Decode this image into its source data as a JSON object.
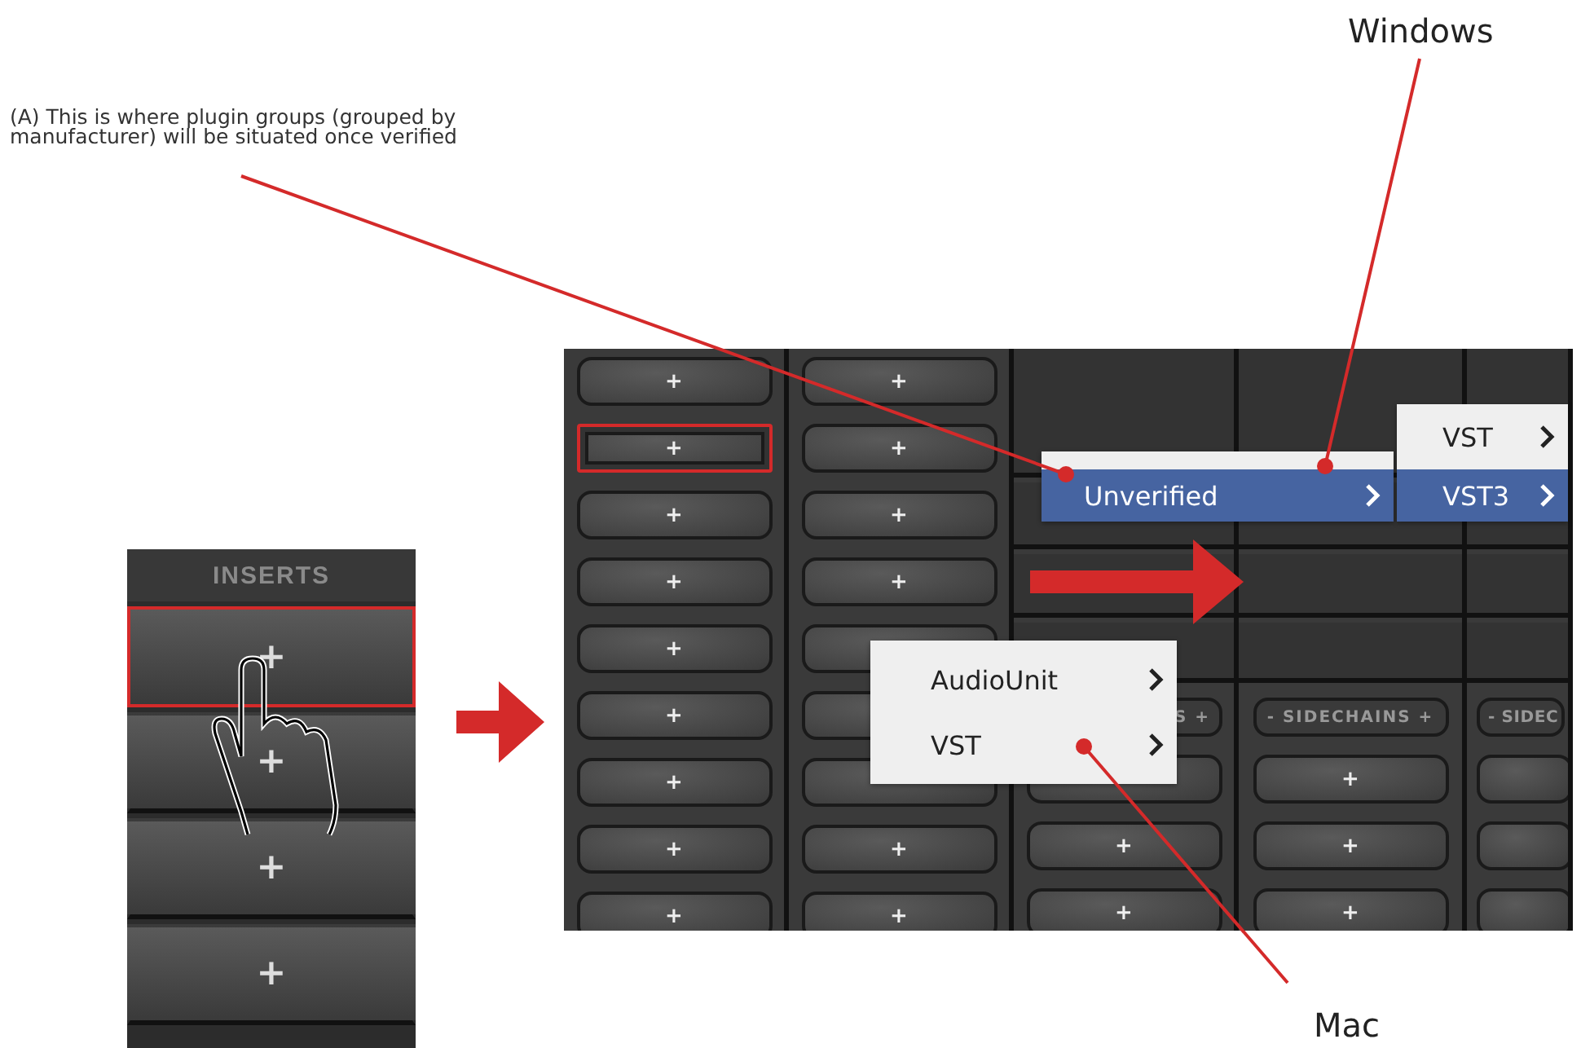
{
  "annotations": {
    "caption": "(A) This is where plugin groups (grouped by manufacturer) will be situated once verified",
    "windows_label": "Windows",
    "mac_label": "Mac"
  },
  "inserts_panel": {
    "header": "INSERTS",
    "slots": [
      {
        "label": "+",
        "highlighted": true
      },
      {
        "label": "+",
        "highlighted": false
      },
      {
        "label": "+",
        "highlighted": false
      },
      {
        "label": "+",
        "highlighted": false
      }
    ]
  },
  "mixer": {
    "columns": [
      {
        "kind": "slots",
        "slots": [
          {
            "kind": "plus",
            "label": "+",
            "highlighted": false
          },
          {
            "kind": "plus",
            "label": "+",
            "highlighted": true
          },
          {
            "kind": "plus",
            "label": "+",
            "highlighted": false
          },
          {
            "kind": "plus",
            "label": "+",
            "highlighted": false
          },
          {
            "kind": "plus",
            "label": "+",
            "highlighted": false
          },
          {
            "kind": "plus",
            "label": "+",
            "highlighted": false
          },
          {
            "kind": "plus",
            "label": "+",
            "highlighted": false
          },
          {
            "kind": "plus",
            "label": "+",
            "highlighted": false
          },
          {
            "kind": "plus",
            "label": "+",
            "highlighted": false
          }
        ]
      },
      {
        "kind": "slots",
        "slots": [
          {
            "kind": "plus",
            "label": "+",
            "highlighted": false
          },
          {
            "kind": "plus",
            "label": "+",
            "highlighted": false
          },
          {
            "kind": "plus",
            "label": "+",
            "highlighted": false
          },
          {
            "kind": "plus",
            "label": "+",
            "highlighted": false
          },
          {
            "kind": "covered",
            "highlighted": false
          },
          {
            "kind": "covered",
            "highlighted": false
          },
          {
            "kind": "covered",
            "highlighted": false
          },
          {
            "kind": "plus",
            "label": "+",
            "highlighted": false
          },
          {
            "kind": "plus",
            "label": "+",
            "highlighted": false
          }
        ]
      },
      {
        "kind": "sidechain",
        "sidechain": {
          "kind": "partial",
          "label": "S +"
        },
        "slots": [
          {
            "kind": "covered",
            "highlighted": false
          },
          {
            "kind": "plus",
            "label": "+",
            "highlighted": false
          },
          {
            "kind": "plus",
            "label": "+",
            "highlighted": false
          }
        ]
      },
      {
        "kind": "sidechain",
        "sidechain": {
          "kind": "full",
          "label": "- SIDECHAINS +"
        },
        "slots": [
          {
            "kind": "plus",
            "label": "+",
            "highlighted": false
          },
          {
            "kind": "plus",
            "label": "+",
            "highlighted": false
          },
          {
            "kind": "plus",
            "label": "+",
            "highlighted": false
          }
        ]
      },
      {
        "kind": "sidechain",
        "sidechain": {
          "kind": "cut",
          "label": "- SIDEC"
        },
        "slots": [
          {
            "kind": "covered",
            "highlighted": false
          },
          {
            "kind": "covered",
            "highlighted": false
          },
          {
            "kind": "covered",
            "highlighted": false
          }
        ]
      }
    ]
  },
  "windows_menu": {
    "items": [
      {
        "label": "Unverified",
        "selected": true
      }
    ],
    "submenu": [
      {
        "label": "VST",
        "selected": false
      },
      {
        "label": "VST3",
        "selected": true
      }
    ]
  },
  "mac_menu": {
    "items": [
      {
        "label": "AudioUnit",
        "selected": false
      },
      {
        "label": "VST",
        "selected": false
      }
    ]
  }
}
